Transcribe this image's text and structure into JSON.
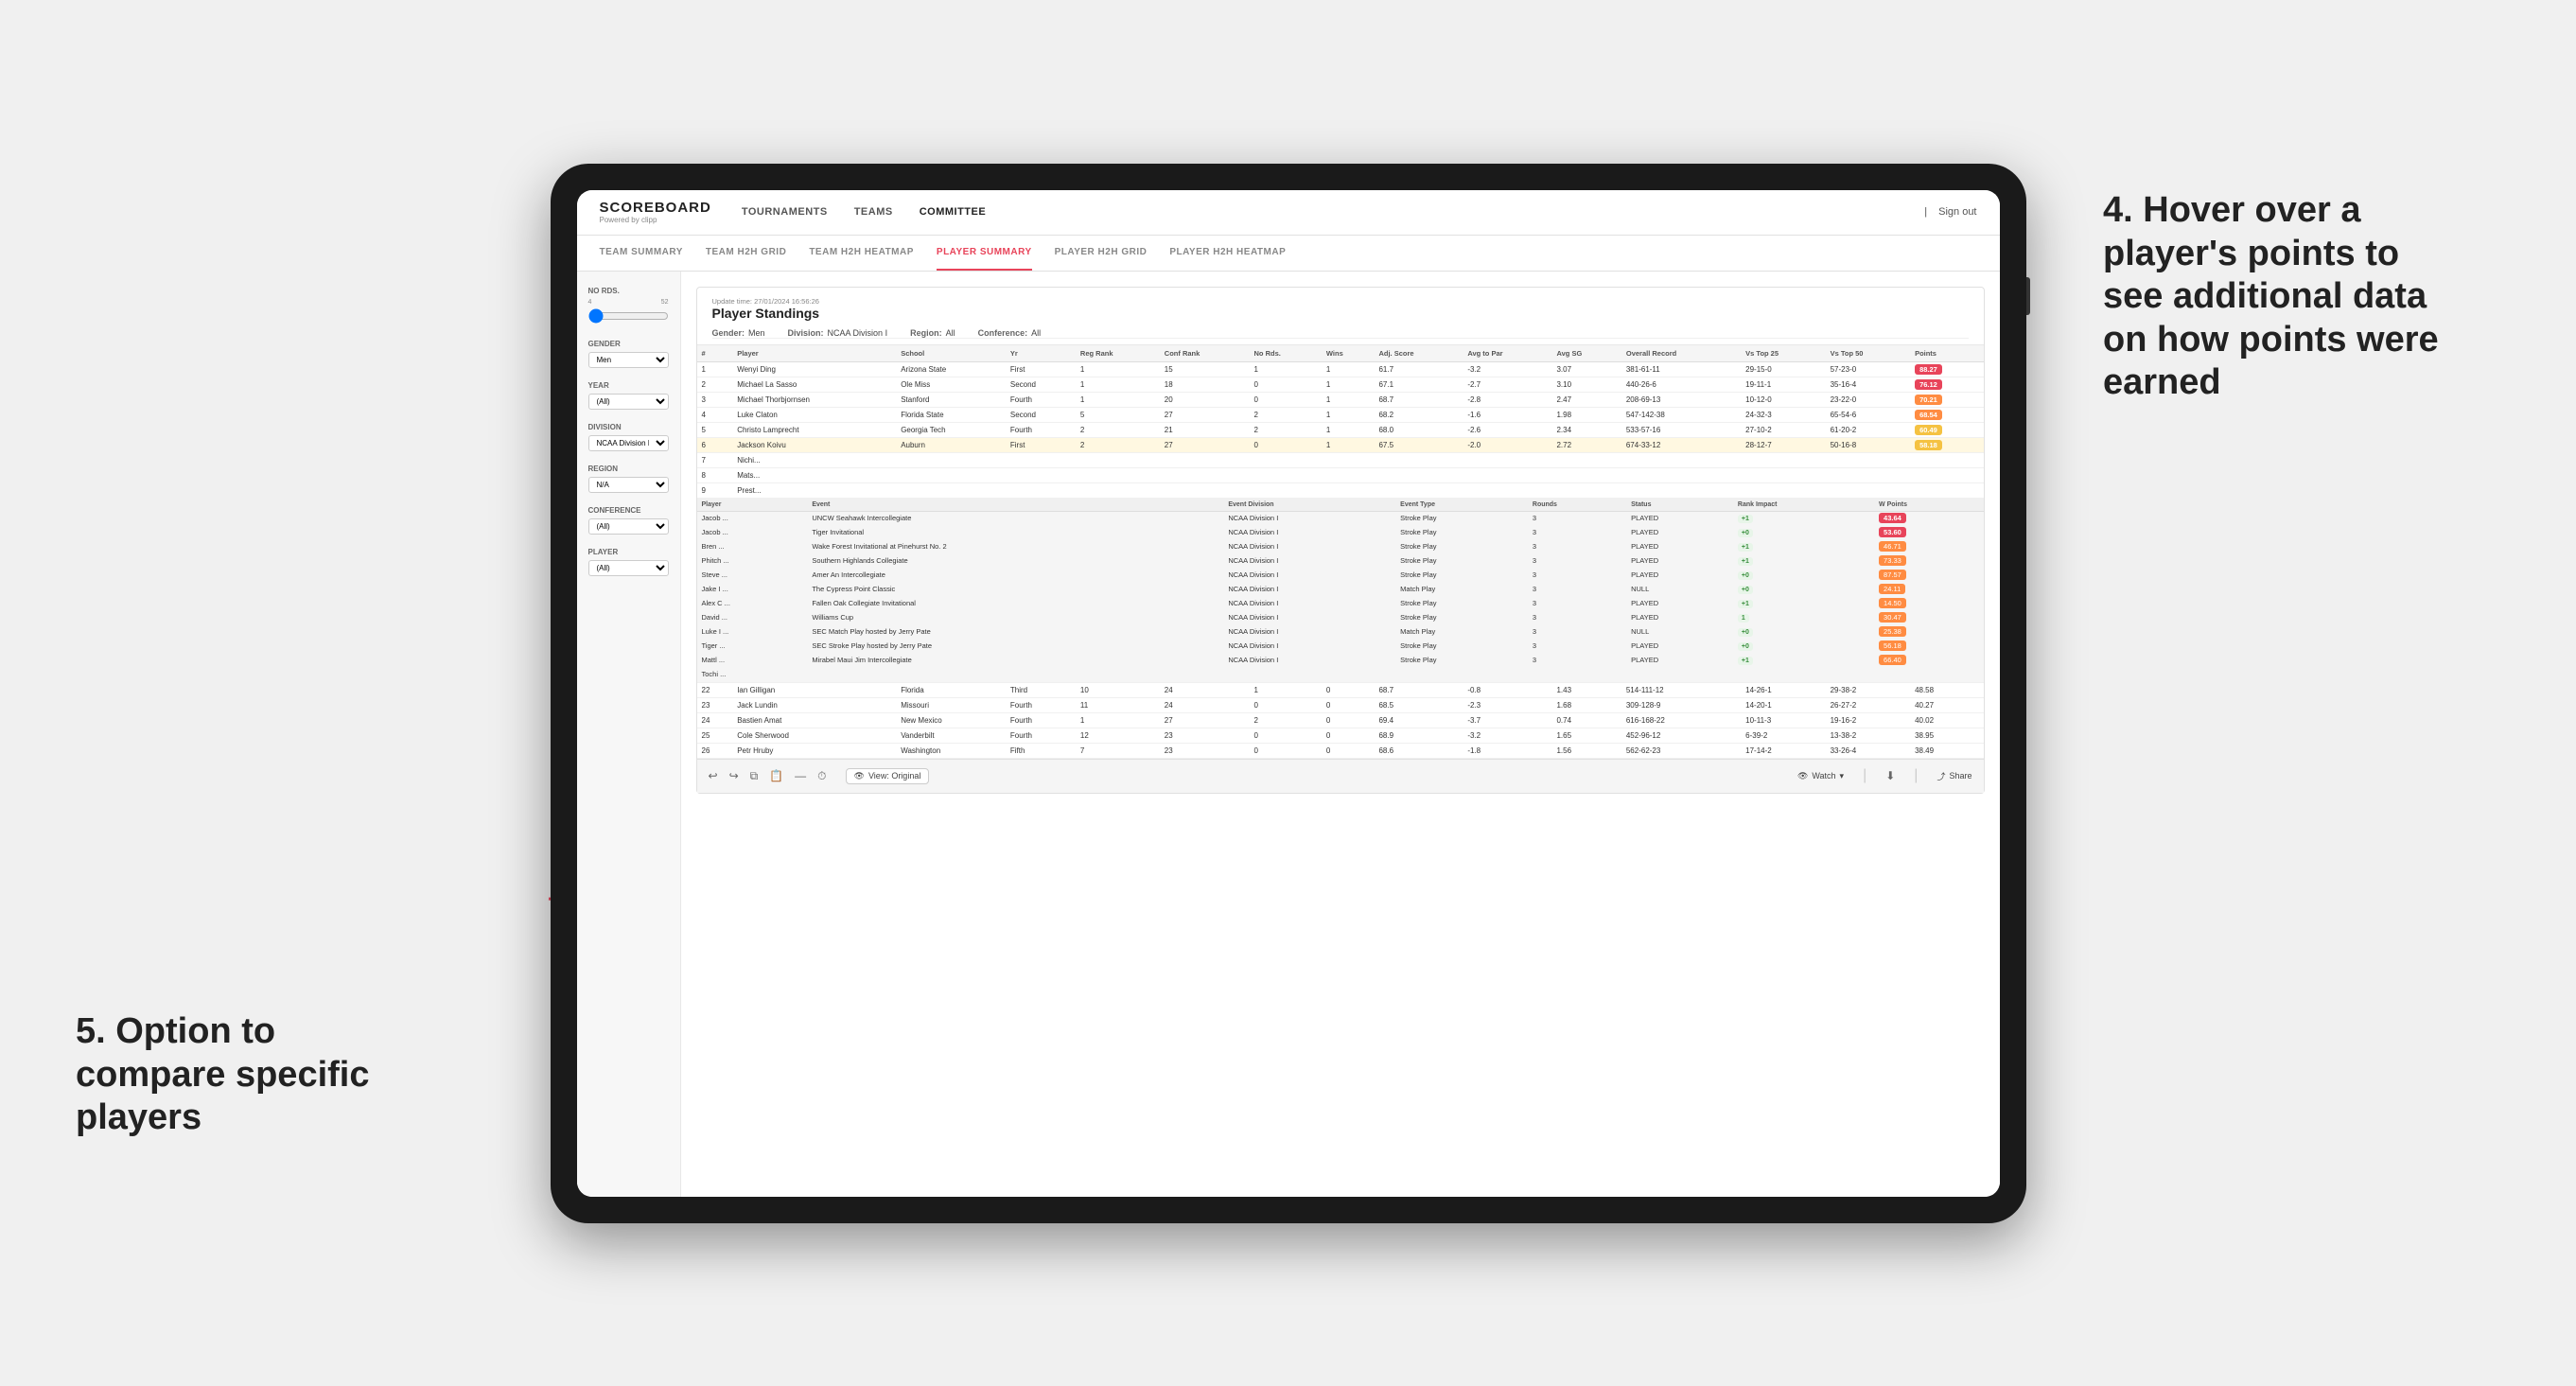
{
  "app": {
    "logo": "SCOREBOARD",
    "logo_sub": "Powered by clipp",
    "sign_out": "Sign out"
  },
  "nav": {
    "items": [
      {
        "label": "TOURNAMENTS",
        "active": false
      },
      {
        "label": "TEAMS",
        "active": false
      },
      {
        "label": "COMMITTEE",
        "active": true
      }
    ]
  },
  "sub_nav": {
    "items": [
      {
        "label": "TEAM SUMMARY",
        "active": false
      },
      {
        "label": "TEAM H2H GRID",
        "active": false
      },
      {
        "label": "TEAM H2H HEATMAP",
        "active": false
      },
      {
        "label": "PLAYER SUMMARY",
        "active": true
      },
      {
        "label": "PLAYER H2H GRID",
        "active": false
      },
      {
        "label": "PLAYER H2H HEATMAP",
        "active": false
      }
    ]
  },
  "sidebar": {
    "no_rds_label": "No Rds.",
    "no_rds_min": "4",
    "no_rds_max": "52",
    "gender_label": "Gender",
    "gender_value": "Men",
    "year_label": "Year",
    "year_value": "(All)",
    "division_label": "Division",
    "division_value": "NCAA Division I",
    "region_label": "Region",
    "region_value": "N/A",
    "conference_label": "Conference",
    "conference_value": "(All)",
    "player_label": "Player",
    "player_value": "(All)"
  },
  "panel": {
    "title": "Player Standings",
    "update_time": "Update time: 27/01/2024 16:56:26",
    "gender": "Men",
    "division": "NCAA Division I",
    "region": "All",
    "conference": "All"
  },
  "table": {
    "headers": [
      "#",
      "Player",
      "School",
      "Yr",
      "Reg Rank",
      "Conf Rank",
      "No Rds.",
      "Wins",
      "Adj. Score",
      "Avg to Par",
      "Avg SG",
      "Overall Record",
      "Vs Top 25",
      "Vs Top 50",
      "Points"
    ],
    "rows": [
      {
        "rank": 1,
        "player": "Wenyi Ding",
        "school": "Arizona State",
        "yr": "First",
        "reg": 1,
        "conf": 15,
        "rds": 1,
        "wins": 1,
        "adj": 61.7,
        "topar": -3.2,
        "sg": 3.07,
        "record": "381-61-11",
        "vt25": "29-15-0",
        "vt50": "57-23-0",
        "points": "88.27",
        "badge": "red"
      },
      {
        "rank": 2,
        "player": "Michael La Sasso",
        "school": "Ole Miss",
        "yr": "Second",
        "reg": 1,
        "conf": 18,
        "rds": 0,
        "wins": 1,
        "adj": 67.1,
        "topar": -2.7,
        "sg": 3.1,
        "record": "440-26-6",
        "vt25": "19-11-1",
        "vt50": "35-16-4",
        "points": "76.12",
        "badge": "orange"
      },
      {
        "rank": 3,
        "player": "Michael Thorbjornsen",
        "school": "Stanford",
        "yr": "Fourth",
        "reg": 1,
        "conf": 20,
        "rds": 0,
        "wins": 1,
        "adj": 68.7,
        "topar": -2.8,
        "sg": 2.47,
        "record": "208-69-13",
        "vt25": "10-12-0",
        "vt50": "23-22-0",
        "points": "70.21",
        "badge": "orange"
      },
      {
        "rank": 4,
        "player": "Luke Claton",
        "school": "Florida State",
        "yr": "Second",
        "reg": 5,
        "conf": 27,
        "rds": 2,
        "wins": 1,
        "adj": 68.2,
        "topar": -1.6,
        "sg": 1.98,
        "record": "547-142-38",
        "vt25": "24-32-3",
        "vt50": "65-54-6",
        "points": "68.54",
        "badge": "orange"
      },
      {
        "rank": 5,
        "player": "Christo Lamprecht",
        "school": "Georgia Tech",
        "yr": "Fourth",
        "reg": 2,
        "conf": 21,
        "rds": 2,
        "wins": 1,
        "adj": 68.0,
        "topar": -2.6,
        "sg": 2.34,
        "record": "533-57-16",
        "vt25": "27-10-2",
        "vt50": "61-20-2",
        "points": "60.49",
        "badge": "yellow"
      },
      {
        "rank": 6,
        "player": "Jackson Koivu",
        "school": "Auburn",
        "yr": "First",
        "reg": 2,
        "conf": 27,
        "rds": 0,
        "wins": 1,
        "adj": 67.5,
        "topar": -2.0,
        "sg": 2.72,
        "record": "674-33-12",
        "vt25": "28-12-7",
        "vt50": "50-16-8",
        "points": "58.18",
        "badge": "yellow",
        "hover": true
      }
    ]
  },
  "sub_table": {
    "player_name": "Jackson Koivu",
    "headers": [
      "Player",
      "Event",
      "Event Division",
      "Event Type",
      "Rounds",
      "Status",
      "Rank Impact",
      "W Points"
    ],
    "rows": [
      {
        "player": "Jacob ...",
        "event": "UNCW Seahawk Intercollegiate",
        "division": "NCAA Division I",
        "type": "Stroke Play",
        "rounds": 3,
        "status": "PLAYED",
        "rank": "+1",
        "rank_type": "pos",
        "points": "43.64"
      },
      {
        "player": "Jacob ...",
        "event": "Tiger Invitational",
        "division": "NCAA Division I",
        "type": "Stroke Play",
        "rounds": 3,
        "status": "PLAYED",
        "rank": "+0",
        "rank_type": "neu",
        "points": "53.60"
      },
      {
        "player": "Brian ...",
        "event": "Wake Forest Invitational at Pinehurst No. 2",
        "division": "NCAA Division I",
        "type": "Stroke Play",
        "rounds": 3,
        "status": "PLAYED",
        "rank": "+1",
        "rank_type": "pos",
        "points": "46.71"
      },
      {
        "player": "Phitch ...",
        "event": "Southern Highlands Collegiate",
        "division": "NCAA Division I",
        "type": "Stroke Play",
        "rounds": 3,
        "status": "PLAYED",
        "rank": "+1",
        "rank_type": "pos",
        "points": "73.33"
      },
      {
        "player": "Steve ...",
        "event": "Amer An Intercollegiate",
        "division": "NCAA Division I",
        "type": "Stroke Play",
        "rounds": 3,
        "status": "PLAYED",
        "rank": "+0",
        "rank_type": "neu",
        "points": "87.57"
      },
      {
        "player": "Jake I ...",
        "event": "The Cypress Point Classic",
        "division": "NCAA Division I",
        "type": "Match Play",
        "rounds": 3,
        "status": "NULL",
        "rank": "+0",
        "rank_type": "neu",
        "points": "24.11"
      },
      {
        "player": "Alex C ...",
        "event": "Fallen Oak Collegiate Invitational",
        "division": "NCAA Division I",
        "type": "Stroke Play",
        "rounds": 3,
        "status": "PLAYED",
        "rank": "+1",
        "rank_type": "pos",
        "points": "14.50"
      },
      {
        "player": "David ...",
        "event": "Williams Cup",
        "division": "NCAA Division I",
        "type": "Stroke Play",
        "rounds": 3,
        "status": "PLAYED",
        "rank": "1",
        "rank_type": "pos",
        "points": "30.47"
      },
      {
        "player": "Luke I ...",
        "event": "SEC Match Play hosted by Jerry Pate",
        "division": "NCAA Division I",
        "type": "Match Play",
        "rounds": 3,
        "status": "NULL",
        "rank": "+0",
        "rank_type": "neu",
        "points": "25.38"
      },
      {
        "player": "Tiger ...",
        "event": "SEC Stroke Play hosted by Jerry Pate",
        "division": "NCAA Division I",
        "type": "Stroke Play",
        "rounds": 3,
        "status": "PLAYED",
        "rank": "+0",
        "rank_type": "neu",
        "points": "56.18"
      },
      {
        "player": "Mattl ...",
        "event": "Mirabel Maui Jim Intercollegiate",
        "division": "NCAA Division I",
        "type": "Stroke Play",
        "rounds": 3,
        "status": "PLAYED",
        "rank": "+1",
        "rank_type": "pos",
        "points": "66.40"
      },
      {
        "player": "Tochi ...",
        "event": "",
        "division": "",
        "type": "",
        "rounds": "",
        "status": "",
        "rank": "",
        "rank_type": "neu",
        "points": ""
      }
    ]
  },
  "lower_rows": [
    {
      "rank": 22,
      "player": "Ian Gilligan",
      "school": "Florida",
      "yr": "Third",
      "reg": 10,
      "conf": 24,
      "rds": 1,
      "wins": 0,
      "adj": 68.7,
      "topar": -0.8,
      "sg": 1.43,
      "record": "514-111-12",
      "vt25": "14-26-1",
      "vt50": "29-38-2",
      "points": "48.58",
      "badge": "none"
    },
    {
      "rank": 23,
      "player": "Jack Lundin",
      "school": "Missouri",
      "yr": "Fourth",
      "reg": 11,
      "conf": 24,
      "rds": 0,
      "wins": 0,
      "adj": 68.5,
      "topar": -2.3,
      "sg": 1.68,
      "record": "309-128-9",
      "vt25": "14-20-1",
      "vt50": "26-27-2",
      "points": "40.27",
      "badge": "none"
    },
    {
      "rank": 24,
      "player": "Bastien Amat",
      "school": "New Mexico",
      "yr": "Fourth",
      "reg": 1,
      "conf": 27,
      "rds": 2,
      "wins": 0,
      "adj": 69.4,
      "topar": -3.7,
      "sg": 0.74,
      "record": "616-168-22",
      "vt25": "10-11-3",
      "vt50": "19-16-2",
      "points": "40.02",
      "badge": "none"
    },
    {
      "rank": 25,
      "player": "Cole Sherwood",
      "school": "Vanderbilt",
      "yr": "Fourth",
      "reg": 12,
      "conf": 23,
      "rds": 0,
      "wins": 0,
      "adj": 68.9,
      "topar": -3.2,
      "sg": 1.65,
      "record": "452-96-12",
      "vt25": "6-39-2",
      "vt50": "13-38-2",
      "points": "38.95",
      "badge": "none"
    },
    {
      "rank": 26,
      "player": "Petr Hruby",
      "school": "Washington",
      "yr": "Fifth",
      "reg": 7,
      "conf": 23,
      "rds": 0,
      "wins": 0,
      "adj": 68.6,
      "topar": -1.8,
      "sg": 1.56,
      "record": "562-62-23",
      "vt25": "17-14-2",
      "vt50": "33-26-4",
      "points": "38.49",
      "badge": "none"
    }
  ],
  "bottom_bar": {
    "view_label": "View: Original",
    "watch_label": "Watch",
    "share_label": "Share"
  },
  "annotations": {
    "right_title": "4. Hover over a player's points to see additional data on how points were earned",
    "left_title": "5. Option to compare specific players"
  }
}
